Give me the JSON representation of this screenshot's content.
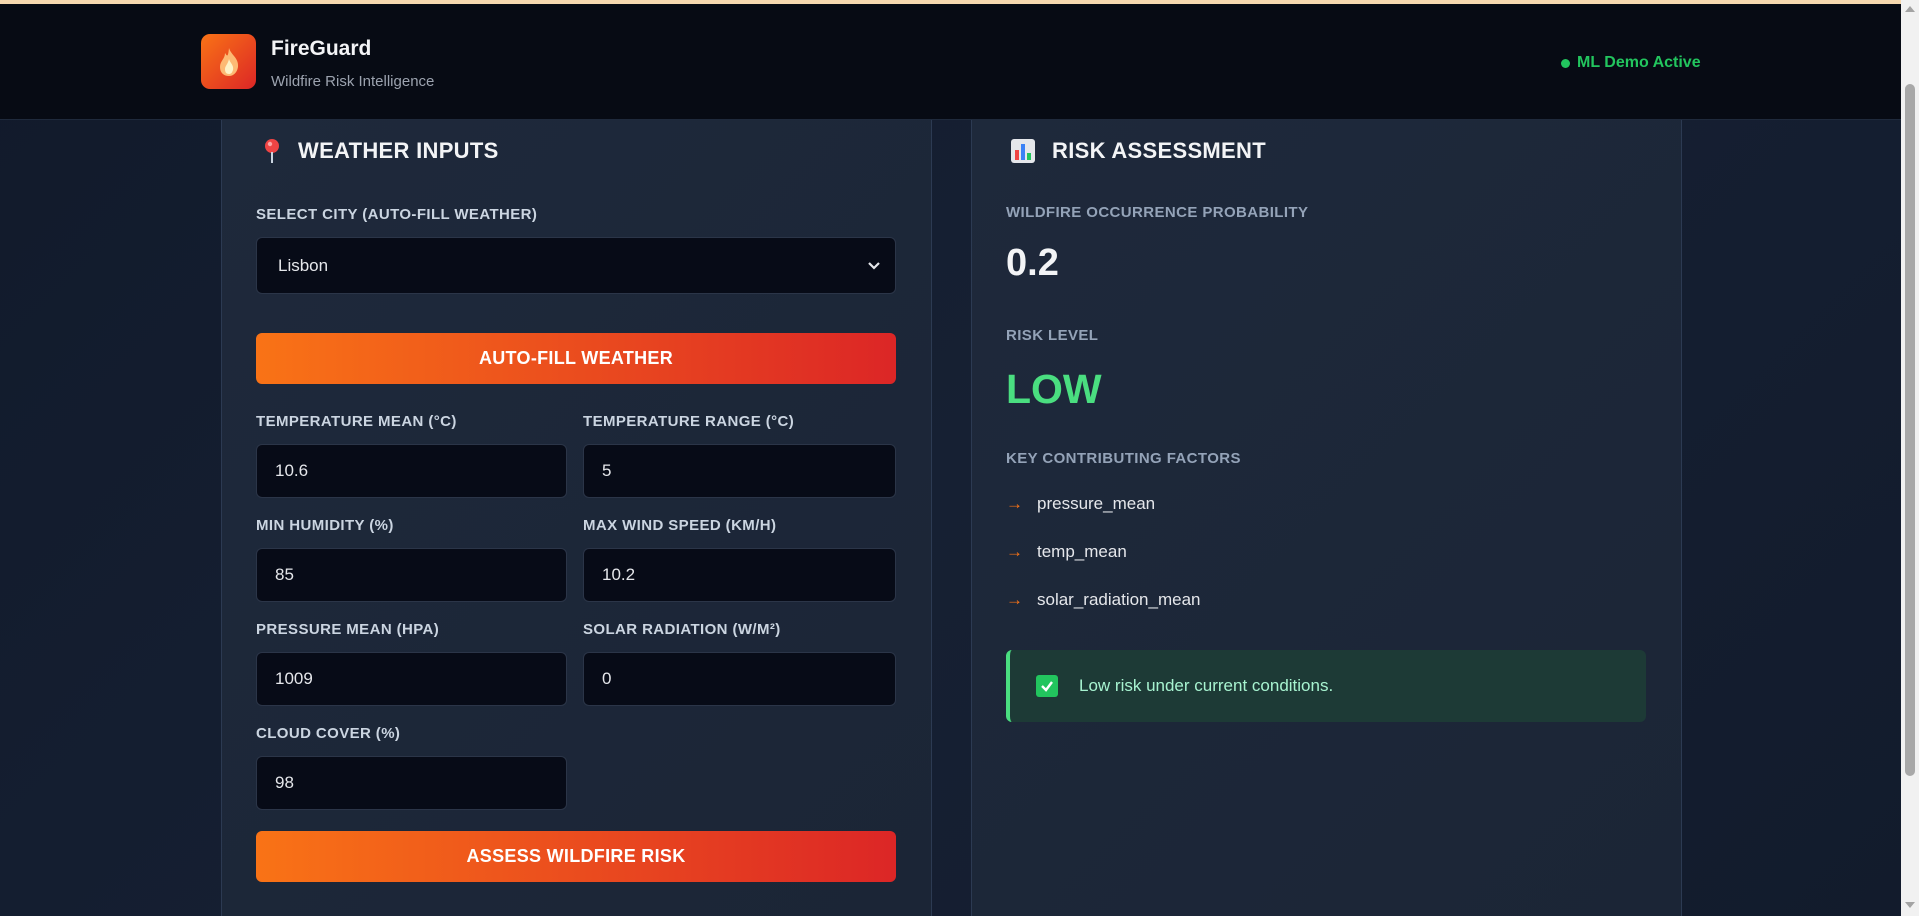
{
  "header": {
    "brand_title": "FireGuard",
    "brand_subtitle": "Wildfire Risk Intelligence",
    "status_text": "ML Demo Active",
    "logo_icon": "flame-icon"
  },
  "weather_panel": {
    "title": "WEATHER INPUTS",
    "title_icon": "map-pin-icon",
    "city_label": "SELECT CITY (AUTO-FILL WEATHER)",
    "city_value": "Lisbon",
    "autofill_label": "AUTO-FILL WEATHER",
    "fields": {
      "temp_mean": {
        "label": "TEMPERATURE MEAN (°C)",
        "value": "10.6"
      },
      "temp_range": {
        "label": "TEMPERATURE RANGE (°C)",
        "value": "5"
      },
      "min_humidity": {
        "label": "MIN HUMIDITY (%)",
        "value": "85"
      },
      "max_wind": {
        "label": "MAX WIND SPEED (KM/H)",
        "value": "10.2"
      },
      "pressure": {
        "label": "PRESSURE MEAN (HPA)",
        "value": "1009"
      },
      "solar": {
        "label": "SOLAR RADIATION (W/M²)",
        "value": "0"
      },
      "cloud": {
        "label": "CLOUD COVER (%)",
        "value": "98"
      }
    },
    "assess_label": "ASSESS WILDFIRE RISK"
  },
  "risk_panel": {
    "title": "RISK ASSESSMENT",
    "title_icon": "bar-chart-icon",
    "prob_label": "WILDFIRE OCCURRENCE PROBABILITY",
    "prob_value": "0.2",
    "level_label": "RISK LEVEL",
    "level_value": "LOW",
    "factors_label": "KEY CONTRIBUTING FACTORS",
    "factors": [
      "pressure_mean",
      "temp_mean",
      "solar_radiation_mean"
    ],
    "factor_arrow": "→",
    "alert_text": "Low risk under current conditions."
  },
  "colors": {
    "accent_orange": "#f97316",
    "accent_red": "#dc2626",
    "success_green": "#4ade80"
  }
}
